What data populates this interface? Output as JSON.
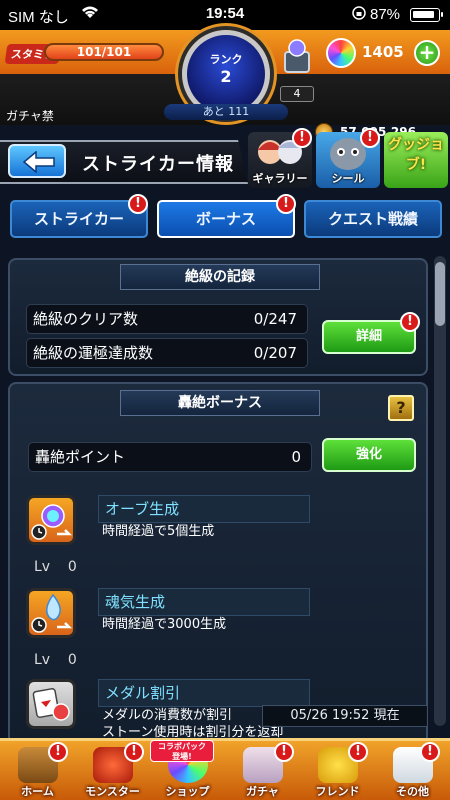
{
  "status_bar": {
    "carrier": "SIM なし",
    "time": "19:54",
    "battery": "87%"
  },
  "header": {
    "stamina_label": "スタミナ",
    "stamina": "101/101",
    "stamina_fill": 1.0,
    "rank_label": "ランク",
    "rank": "2",
    "rank_remaining": "あと 111",
    "gift_count": "4",
    "orbs": "1405",
    "gacha_ban": "ガチャ禁",
    "coins": "57,095,296"
  },
  "titlebar": {
    "title": "ストライカー情報",
    "shortcuts": [
      {
        "label": "ギャラリー"
      },
      {
        "label": "シール"
      },
      {
        "label": "グッジョブ!"
      }
    ]
  },
  "tabs": [
    {
      "label": "ストライカー"
    },
    {
      "label": "ボーナス"
    },
    {
      "label": "クエスト戦績"
    }
  ],
  "zekkyu": {
    "title": "絶級の記録",
    "rows": [
      {
        "label": "絶級のクリア数",
        "value": "0/247"
      },
      {
        "label": "絶級の運極達成数",
        "value": "0/207"
      }
    ],
    "detail_button": "詳細"
  },
  "gouzetsu": {
    "title": "轟絶ボーナス",
    "help": "?",
    "points_label": "轟絶ポイント",
    "points_value": "0",
    "enhance_button": "強化",
    "bonuses": [
      {
        "name": "オーブ生成",
        "desc": "時間経過で5個生成",
        "lv_label": "Lv",
        "lv": "0"
      },
      {
        "name": "魂気生成",
        "desc": "時間経過で3000生成",
        "lv_label": "Lv",
        "lv": "0"
      },
      {
        "name": "メダル割引",
        "desc": "メダルの消費数が割引",
        "desc2": "ストーン使用時は割引分を返却"
      }
    ]
  },
  "datetime": "05/26 19:52 現在",
  "collab_tag": "コラボパック\n登場!",
  "bottom_nav": [
    {
      "label": "ホーム"
    },
    {
      "label": "モンスター"
    },
    {
      "label": "ショップ"
    },
    {
      "label": "ガチャ"
    },
    {
      "label": "フレンド"
    },
    {
      "label": "その他"
    }
  ],
  "colors": {
    "header_orange": "#e07a14",
    "tab_blue": "#1b63b8",
    "green_button": "#3cc42a",
    "badge_red": "#d81a1a"
  }
}
